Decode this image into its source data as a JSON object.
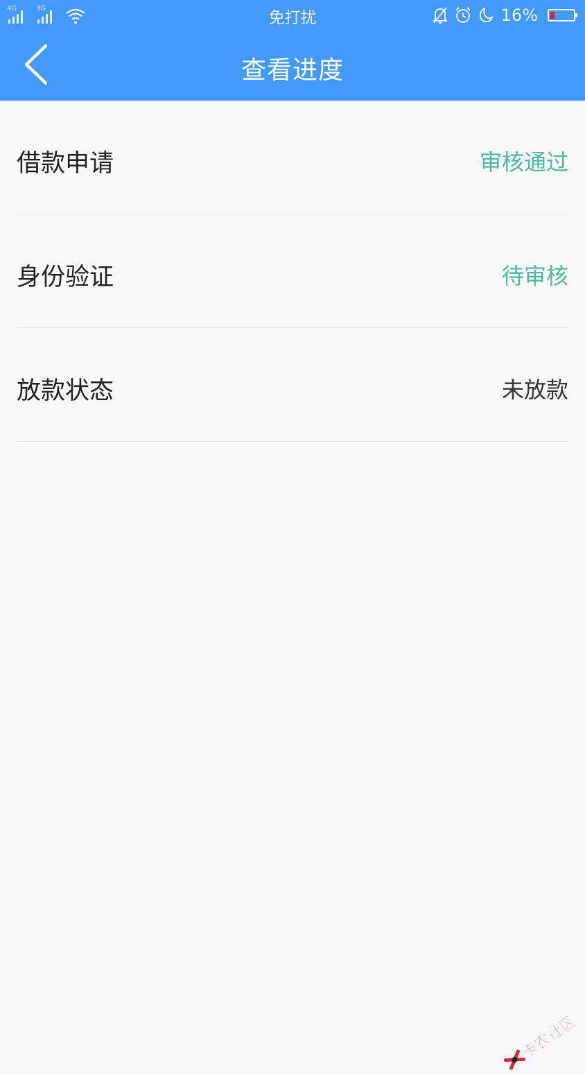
{
  "status_bar": {
    "network1": "4G",
    "network2": "3G",
    "mode": "免打扰",
    "battery_percent": "16%"
  },
  "nav": {
    "title": "查看进度"
  },
  "rows": [
    {
      "label": "借款申请",
      "value": "审核通过"
    },
    {
      "label": "身份验证",
      "value": "待审核"
    },
    {
      "label": "放款状态",
      "value": "未放款"
    }
  ],
  "watermark": {
    "text": "卡农社区"
  },
  "colors": {
    "header_bg": "#4499ff",
    "status_green": "#4bb99a",
    "battery_low": "#e8192c"
  }
}
